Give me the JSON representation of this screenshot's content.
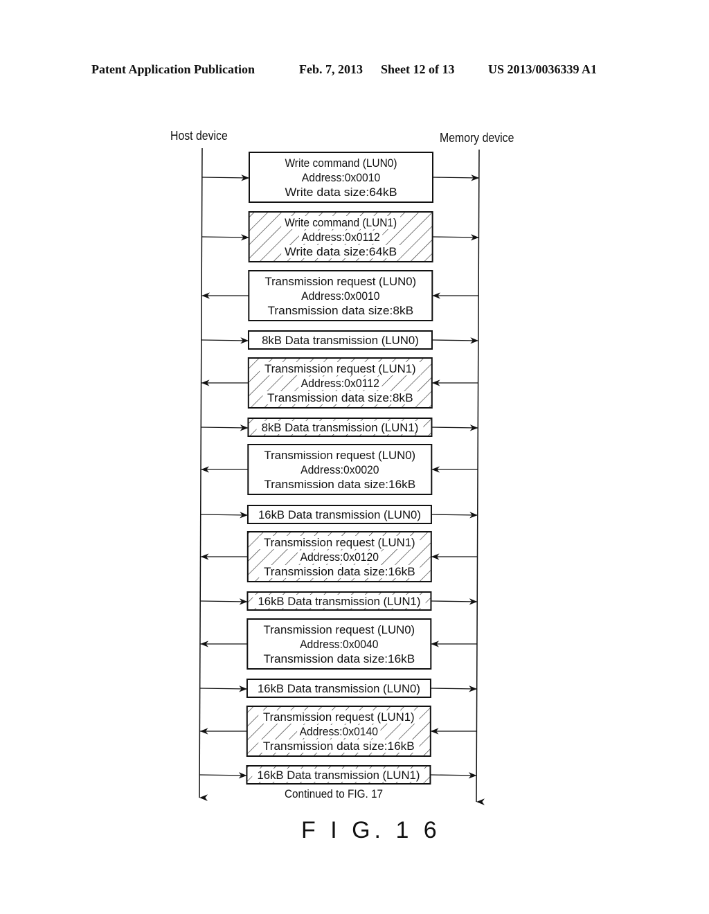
{
  "header": {
    "publication": "Patent Application Publication",
    "date": "Feb. 7, 2013",
    "sheet": "Sheet 12 of 13",
    "number": "US 2013/0036339 A1"
  },
  "lanes": {
    "left": "Host device",
    "right": "Memory device"
  },
  "messages": [
    {
      "lines": [
        "Write command (LUN0)",
        "Address:0x0010",
        "Write data size:64kB"
      ],
      "direction": "host-to-memory",
      "lun": 0,
      "hatched": false
    },
    {
      "lines": [
        "Write command (LUN1)",
        "Address:0x0112",
        "Write data size:64kB"
      ],
      "direction": "host-to-memory",
      "lun": 1,
      "hatched": true
    },
    {
      "lines": [
        "Transmission request (LUN0)",
        "Address:0x0010",
        "Transmission data size:8kB"
      ],
      "direction": "memory-to-host",
      "lun": 0,
      "hatched": false
    },
    {
      "lines": [
        "8kB Data transmission (LUN0)"
      ],
      "direction": "host-to-memory",
      "lun": 0,
      "hatched": false
    },
    {
      "lines": [
        "Transmission request (LUN1)",
        "Address:0x0112",
        "Transmission data size:8kB"
      ],
      "direction": "memory-to-host",
      "lun": 1,
      "hatched": true
    },
    {
      "lines": [
        "8kB Data transmission (LUN1)"
      ],
      "direction": "host-to-memory",
      "lun": 1,
      "hatched": true
    },
    {
      "lines": [
        "Transmission request (LUN0)",
        "Address:0x0020",
        "Transmission data size:16kB"
      ],
      "direction": "memory-to-host",
      "lun": 0,
      "hatched": false
    },
    {
      "lines": [
        "16kB Data transmission (LUN0)"
      ],
      "direction": "host-to-memory",
      "lun": 0,
      "hatched": false
    },
    {
      "lines": [
        "Transmission request (LUN1)",
        "Address:0x0120",
        "Transmission data size:16kB"
      ],
      "direction": "memory-to-host",
      "lun": 1,
      "hatched": true
    },
    {
      "lines": [
        "16kB Data transmission (LUN1)"
      ],
      "direction": "host-to-memory",
      "lun": 1,
      "hatched": true
    },
    {
      "lines": [
        "Transmission request (LUN0)",
        "Address:0x0040",
        "Transmission data size:16kB"
      ],
      "direction": "memory-to-host",
      "lun": 0,
      "hatched": false
    },
    {
      "lines": [
        "16kB Data transmission (LUN0)"
      ],
      "direction": "host-to-memory",
      "lun": 0,
      "hatched": false
    },
    {
      "lines": [
        "Transmission request (LUN1)",
        "Address:0x0140",
        "Transmission data size:16kB"
      ],
      "direction": "memory-to-host",
      "lun": 1,
      "hatched": true
    },
    {
      "lines": [
        "16kB Data transmission (LUN1)"
      ],
      "direction": "host-to-memory",
      "lun": 1,
      "hatched": true
    }
  ],
  "continuation": "Continued to FIG. 17",
  "figure_label": "F I G. 1 6"
}
